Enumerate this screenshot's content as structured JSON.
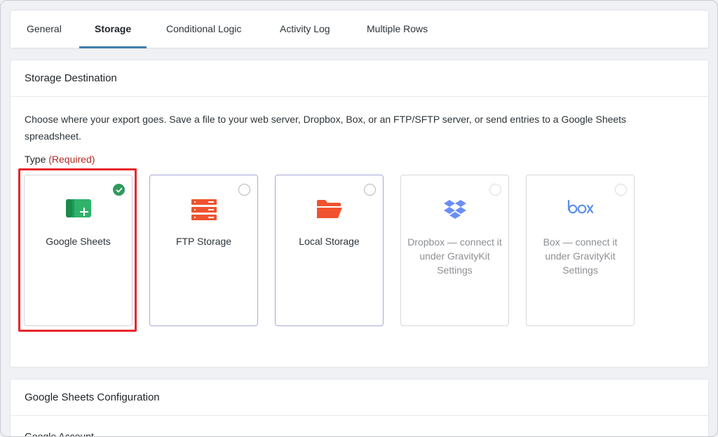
{
  "tabs": [
    {
      "label": "General"
    },
    {
      "label": "Storage"
    },
    {
      "label": "Conditional Logic"
    },
    {
      "label": "Activity Log"
    },
    {
      "label": "Multiple Rows"
    }
  ],
  "storage": {
    "title": "Storage Destination",
    "description": "Choose where your export goes. Save a file to your web server, Dropbox, Box, or an FTP/SFTP server, or send entries to a Google Sheets spreadsheet.",
    "type_label": "Type",
    "required_label": "(Required)",
    "options": [
      {
        "label": "Google Sheets",
        "icon": "google-sheets-icon",
        "selected": true
      },
      {
        "label": "FTP Storage",
        "icon": "server-icon",
        "selected": false
      },
      {
        "label": "Local Storage",
        "icon": "folder-icon",
        "selected": false
      },
      {
        "label": "Dropbox — connect it under GravityKit Settings",
        "icon": "dropbox-icon",
        "selected": false
      },
      {
        "label": "Box — connect it under GravityKit Settings",
        "icon": "box-logo-icon",
        "selected": false
      }
    ]
  },
  "config": {
    "title": "Google Sheets Configuration",
    "account_label": "Google Account"
  },
  "colors": {
    "accent": "#3e7fa9",
    "selected_check": "#2f9a5c",
    "highlight": "#e8262b",
    "required": "#b02a26",
    "icon_orange": "#f0522f",
    "icon_blue": "#5b7ff0"
  }
}
